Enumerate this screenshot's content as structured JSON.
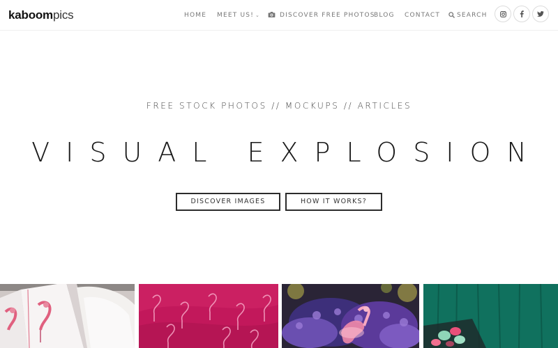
{
  "brand": {
    "logo_bold": "kaboom",
    "logo_light": "pics"
  },
  "nav": {
    "home": "HOME",
    "meet_us": "MEET US!",
    "discover_free_photos": "DISCOVER FREE PHOTOS",
    "blog": "BLOG",
    "contact": "CONTACT",
    "search": "SEARCH"
  },
  "social": [
    {
      "icon": "instagram-icon"
    },
    {
      "icon": "facebook-icon"
    },
    {
      "icon": "twitter-icon"
    }
  ],
  "hero": {
    "subtitle": "FREE STOCK PHOTOS // MOCKUPS // ARTICLES",
    "title": "VISUAL EXPLOSION",
    "buttons": {
      "discover_images": "DISCOVER IMAGES",
      "how_it_works": "HOW IT WORKS?"
    }
  },
  "colors": {
    "accent_text": "#777777",
    "button_border": "#2b2b2b",
    "flamingo_pink": "#c2185b",
    "teal": "#0f6b5a",
    "violet": "#5b3a9a"
  }
}
